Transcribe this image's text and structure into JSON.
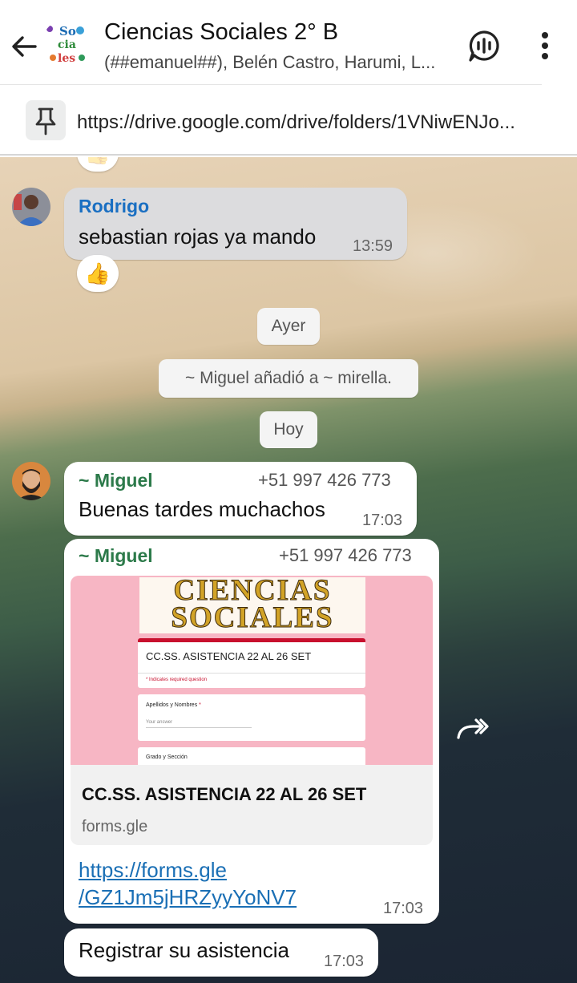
{
  "header": {
    "group_name": "Ciencias Sociales 2° B",
    "members": "(##emanuel##), Belén Castro, Harumi, L...",
    "group_icon_text": [
      "So",
      "cia",
      "les"
    ]
  },
  "pinned": {
    "text": "https://drive.google.com/drive/folders/1VNiwENJo..."
  },
  "messages": {
    "rodrigo": {
      "sender": "Rodrigo",
      "text": "sebastian rojas ya mando",
      "time": "13:59",
      "reaction": "👍"
    },
    "date_yesterday": "Ayer",
    "system_note": "~ Miguel añadió a ~ mirella.",
    "date_today": "Hoy",
    "miguel1": {
      "sender": "~ Miguel",
      "phone": "+51 997 426 773",
      "text": "Buenas tardes muchachos",
      "time": "17:03"
    },
    "miguel2": {
      "sender": "~ Miguel",
      "phone": "+51 997 426 773",
      "preview": {
        "logo_line1": "CIENCIAS",
        "logo_line2": "SOCIALES",
        "form_title": "CC.SS. ASISTENCIA 22 AL 26 SET",
        "form_required": "* Indicates required question",
        "field1_label": "Apellidos y Nombres",
        "field1_required": "*",
        "field1_placeholder": "Your answer",
        "field2_label": "Grado y Sección",
        "title": "CC.SS. ASISTENCIA 22 AL 26 SET",
        "domain": "forms.gle"
      },
      "link_line1": "https://forms.gle",
      "link_line2": "/GZ1Jm5jHRZyyYoNV7",
      "time": "17:03"
    },
    "miguel3": {
      "text": "Registrar su asistencia",
      "time": "17:03"
    }
  },
  "colors": {
    "rodrigo_name": "#1a6fc2",
    "miguel_name": "#2c7a4a",
    "link": "#1a6fb5",
    "form_accent": "#c8102e"
  },
  "icons": [
    "back-arrow-icon",
    "voice-call-icon",
    "more-vert-icon",
    "pin-icon",
    "thumbs-up-icon",
    "forward-icon"
  ]
}
